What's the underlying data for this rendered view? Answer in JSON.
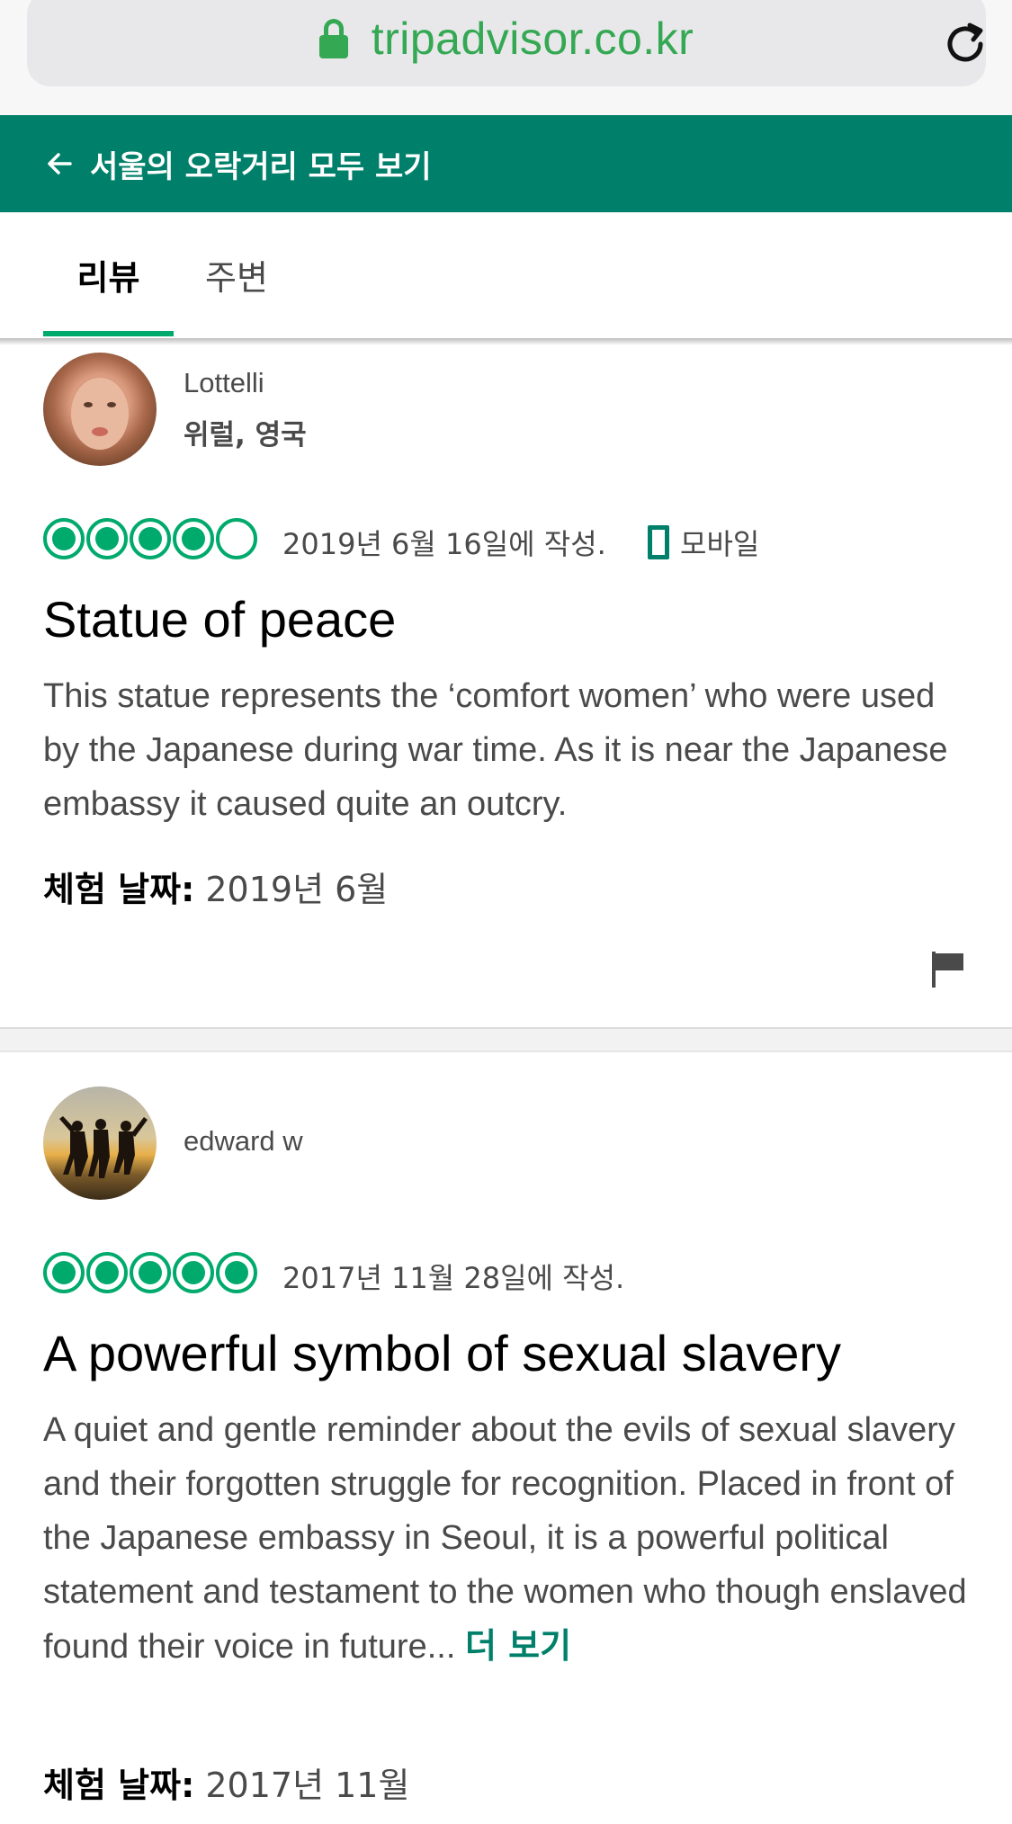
{
  "browser": {
    "url": "tripadvisor.co.kr",
    "lock_icon": "lock-icon",
    "reload_icon": "reload-icon"
  },
  "header": {
    "back_label": "서울의 오락거리 모두 보기",
    "back_icon": "arrow-left-icon",
    "background": "#00806a"
  },
  "tabs": [
    {
      "label": "리뷰",
      "active": true
    },
    {
      "label": "주변",
      "active": false
    }
  ],
  "reviews": [
    {
      "reviewer_name": "Lottelli",
      "reviewer_location": "위럴, 영국",
      "rating": 4,
      "rating_max": 5,
      "date": "2019년 6월 16일에 작성.",
      "device": "모바일",
      "title": "Statue of peace",
      "body": "This statue represents the ‘comfort women’ who were used by the Japanese during war time. As it is near the Japanese embassy it caused quite an outcry.",
      "experience_label": "체험 날짜:",
      "experience_date": "2019년 6월"
    },
    {
      "reviewer_name": "edward w",
      "rating": 5,
      "rating_max": 5,
      "date": "2017년 11월 28일에 작성.",
      "title": "A powerful symbol of sexual slavery",
      "body": "A quiet and gentle reminder about the evils of sexual slavery and their forgotten struggle for recognition. Placed in front of the Japanese embassy in Seoul, it is a powerful political statement and testament to the women who though enslaved found their voice in future...",
      "read_more": "더 보기",
      "experience_label": "체험 날짜:",
      "experience_date": "2017년 11월"
    }
  ],
  "colors": {
    "accent": "#00aa6c",
    "brand_dark": "#00806a",
    "url_green": "#34a853"
  }
}
